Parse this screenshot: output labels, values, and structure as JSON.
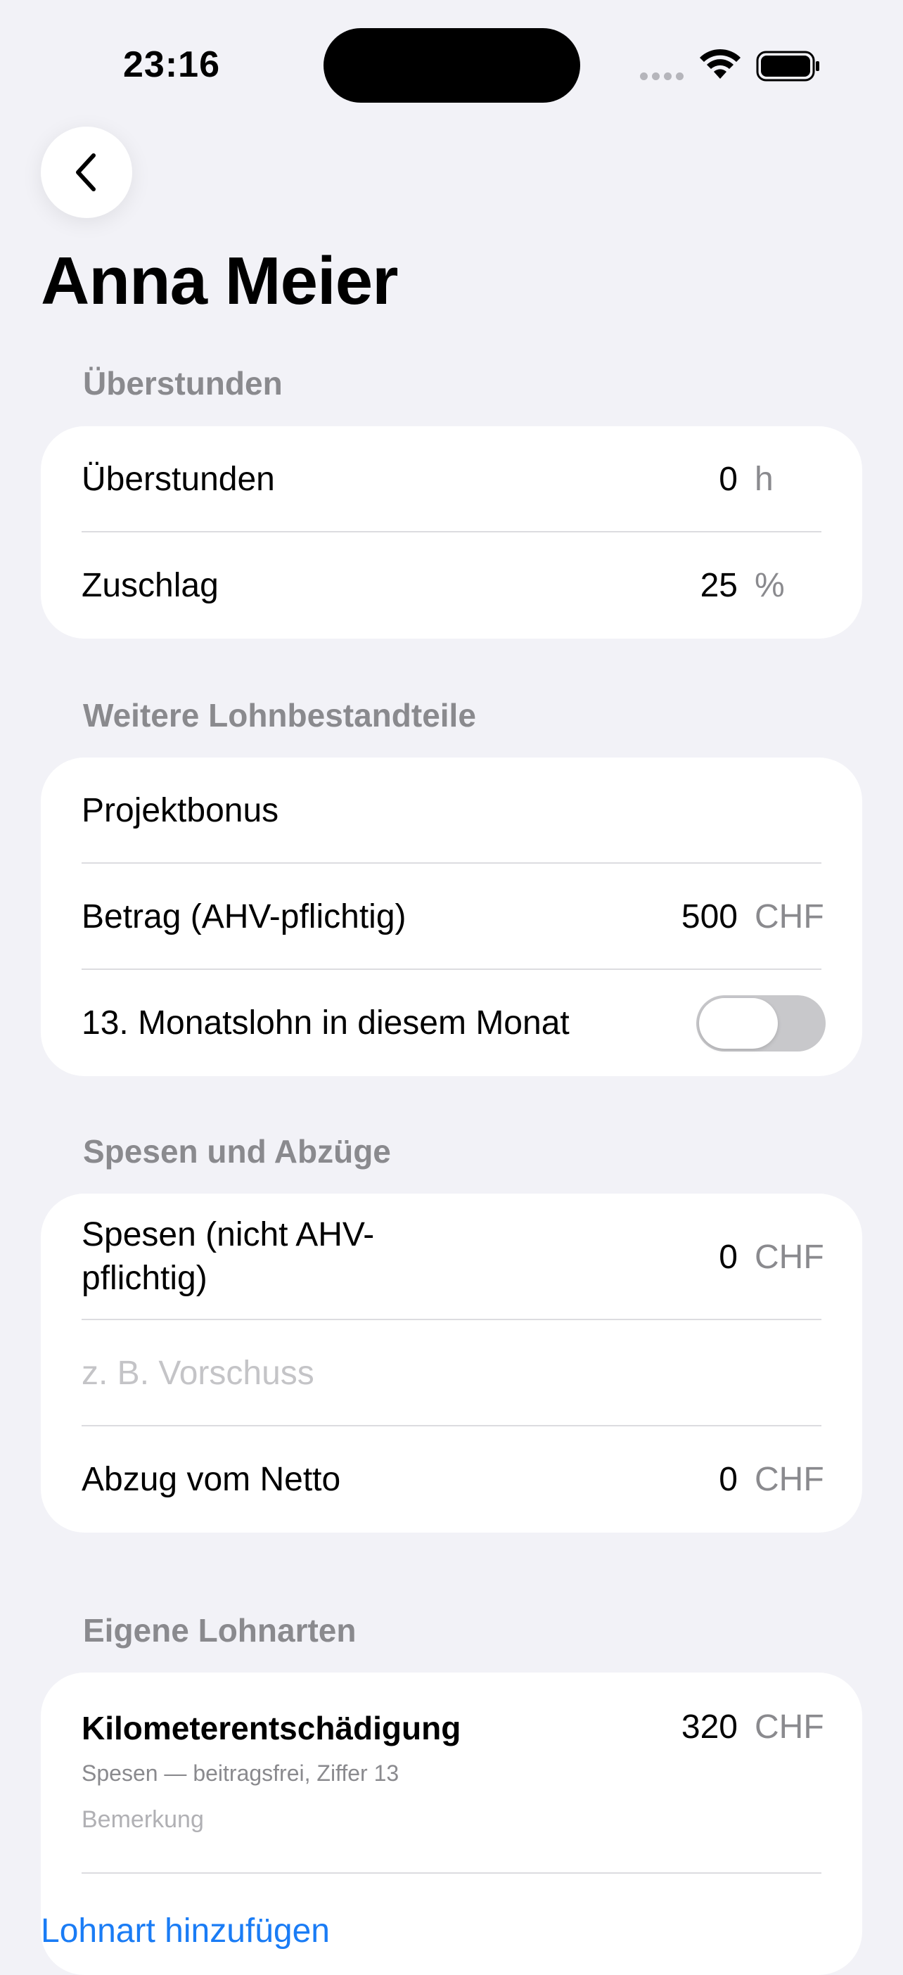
{
  "status_bar": {
    "time": "23:16"
  },
  "page": {
    "title": "Anna Meier"
  },
  "overtime": {
    "header": "Überstunden",
    "rows": [
      {
        "label": "Überstunden",
        "value": "0",
        "unit": "h"
      },
      {
        "label": "Zuschlag",
        "value": "25",
        "unit": "%"
      }
    ]
  },
  "wage_components": {
    "header": "Weitere Lohnbestandteile",
    "name_value": "Projektbonus",
    "amount": {
      "label": "Betrag (AHV-pflichtig)",
      "value": "500",
      "unit": "CHF"
    },
    "thirteenth": {
      "label": "13. Monatslohn in diesem Monat",
      "enabled": false
    }
  },
  "expenses": {
    "header": "Spesen und Abzüge",
    "expenses_row": {
      "label": "Spesen (nicht AHV-pflichtig)",
      "value": "0",
      "unit": "CHF"
    },
    "note_placeholder": "z. B. Vorschuss",
    "deduction_row": {
      "label": "Abzug vom Netto",
      "value": "0",
      "unit": "CHF"
    }
  },
  "custom_wage_types": {
    "header": "Eigene Lohnarten",
    "items": [
      {
        "title": "Kilometerentschädigung",
        "subtitle": "Spesen — beitragsfrei, Ziffer 13",
        "note_placeholder": "Bemerkung",
        "value": "320",
        "unit": "CHF"
      }
    ],
    "add_label": "Lohnart hinzufügen"
  },
  "colors": {
    "accent": "#1a7cf5",
    "background": "#f2f2f7",
    "secondary_text": "#8a8a8e"
  }
}
